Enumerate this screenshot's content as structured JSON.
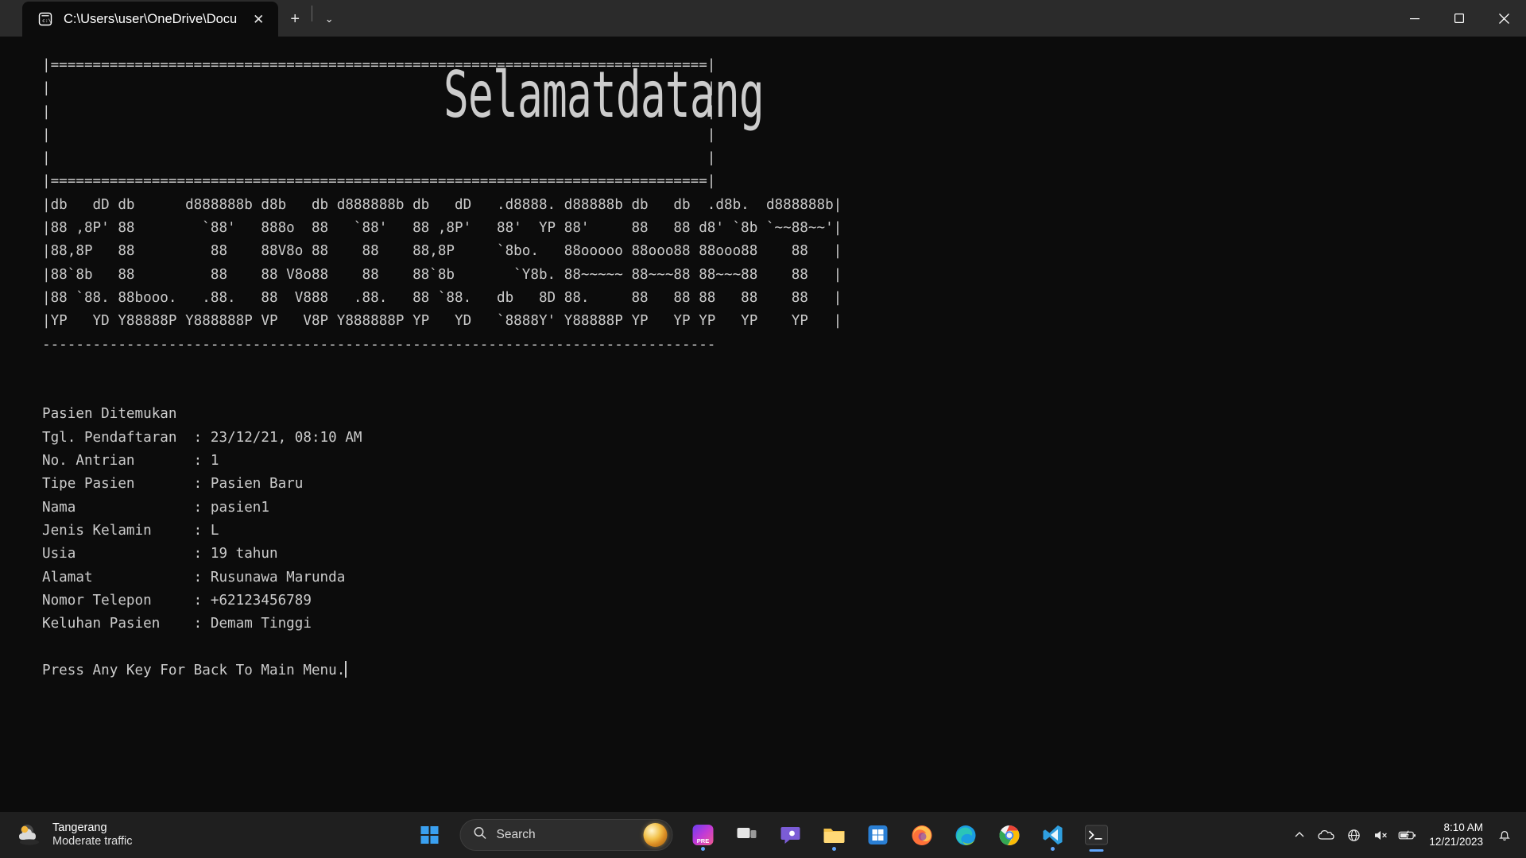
{
  "window": {
    "tab": {
      "icon": "console-cmd-icon",
      "title": "C:\\Users\\user\\OneDrive\\Docu",
      "close_label": "✕"
    },
    "new_tab_label": "+",
    "tab_menu_label": "⌄",
    "controls": {
      "minimize": "minimize-icon",
      "maximize": "maximize-icon",
      "close": "close-icon"
    }
  },
  "terminal": {
    "banner_word": "Selamatdatang",
    "banner_top_lines": [
      "|==============================================================================|",
      "|                                                                              |",
      "|                                                                              |",
      "|                                                                              |",
      "|                                                                              |",
      "|==============================================================================|"
    ],
    "ascii_art": [
      "|db   dD db      d888888b d8b   db d888888b db   dD   .d8888. d88888b db   db  .d8b.  d888888b|",
      "|88 ,8P' 88        `88'   888o  88   `88'   88 ,8P'   88'  YP 88'     88   88 d8' `8b `~~88~~'|",
      "|88,8P   88         88    88V8o 88    88    88,8P     `8bo.   88ooooo 88ooo88 88ooo88    88   |",
      "|88`8b   88         88    88 V8o88    88    88`8b       `Y8b. 88~~~~~ 88~~~88 88~~~88    88   |",
      "|88 `88. 88booo.   .88.   88  V888   .88.   88 `88.   db   8D 88.     88   88 88   88    88   |",
      "|YP   YD Y88888P Y888888P VP   V8P Y888888P YP   YD   `8888Y' Y88888P YP   YP YP   YP    YP   |"
    ],
    "bottom_rule": "--------------------------------------------------------------------------------",
    "status_line": "Pasien Ditemukan",
    "fields": [
      {
        "label": "Tgl. Pendaftaran",
        "sep": ":",
        "value": "23/12/21, 08:10 AM"
      },
      {
        "label": "No. Antrian",
        "sep": ":",
        "value": "1"
      },
      {
        "label": "Tipe Pasien",
        "sep": ":",
        "value": "Pasien Baru"
      },
      {
        "label": "Nama",
        "sep": ":",
        "value": "pasien1"
      },
      {
        "label": "Jenis Kelamin",
        "sep": ":",
        "value": "L"
      },
      {
        "label": "Usia",
        "sep": ":",
        "value": "19 tahun"
      },
      {
        "label": "Alamat",
        "sep": ":",
        "value": "Rusunawa Marunda"
      },
      {
        "label": "Nomor Telepon",
        "sep": ":",
        "value": "+62123456789"
      },
      {
        "label": "Keluhan Pasien",
        "sep": ":",
        "value": "Demam Tinggi"
      }
    ],
    "prompt_line": "Press Any Key For Back To Main Menu.",
    "foreground_color": "#cccccc",
    "background_color": "#0c0c0c"
  },
  "taskbar": {
    "weather": {
      "icon": "weather-cloud-icon",
      "title": "Tangerang",
      "subtitle": "Moderate traffic"
    },
    "start_label": "start-icon",
    "search": {
      "icon": "search-icon",
      "placeholder": "Search",
      "orb": "copilot-orb-icon"
    },
    "pinned": [
      {
        "name": "premiere-pro",
        "label": "PRE"
      },
      {
        "name": "task-view",
        "label": ""
      },
      {
        "name": "chat-teams",
        "label": ""
      },
      {
        "name": "file-explorer",
        "label": ""
      },
      {
        "name": "microsoft-store",
        "label": ""
      },
      {
        "name": "firefox",
        "label": ""
      },
      {
        "name": "microsoft-edge",
        "label": ""
      },
      {
        "name": "google-chrome",
        "label": ""
      },
      {
        "name": "vs-code",
        "label": ""
      },
      {
        "name": "windows-terminal",
        "label": ""
      }
    ],
    "tray": {
      "chevron": "chevron-up-icon",
      "onedrive": "onedrive-icon",
      "network": "network-globe-icon",
      "volume": "volume-muted-icon",
      "battery": "battery-icon",
      "notification": "bell-icon"
    },
    "clock": {
      "time": "8:10 AM",
      "date": "12/21/2023"
    },
    "accent_color": "#60a5fa"
  }
}
